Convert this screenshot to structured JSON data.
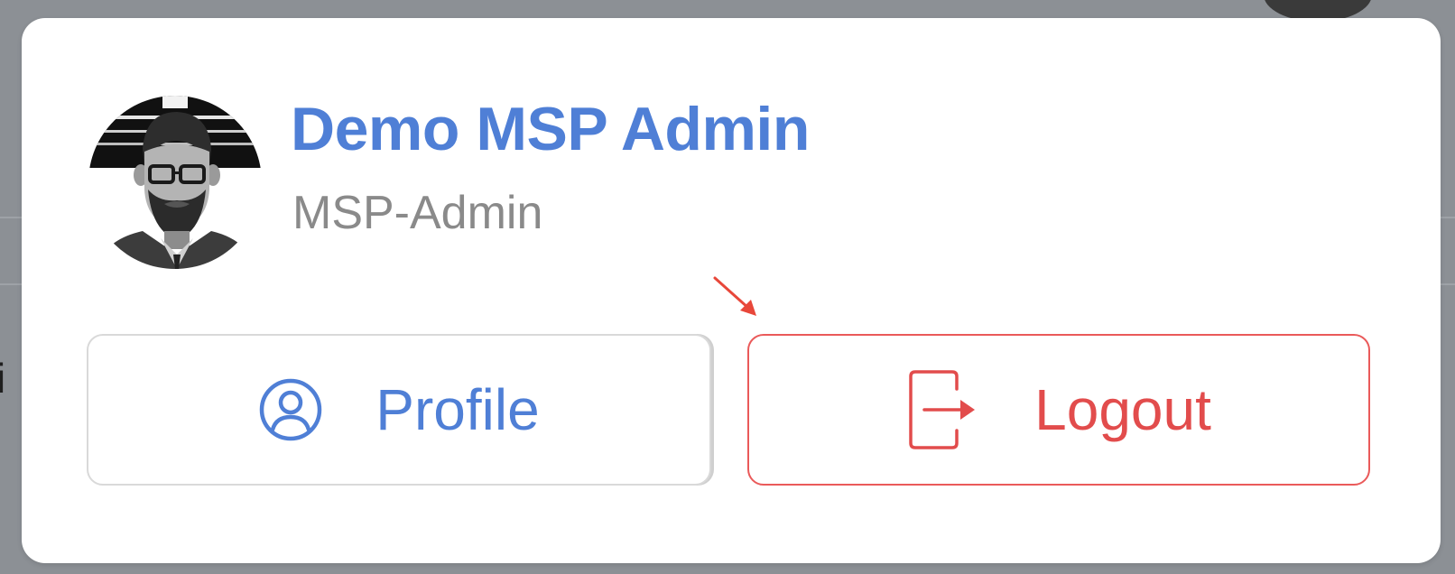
{
  "user": {
    "name": "Demo MSP Admin",
    "role": "MSP-Admin"
  },
  "actions": {
    "profile_label": "Profile",
    "logout_label": "Logout"
  },
  "background": {
    "partial_text": "i"
  },
  "icons": {
    "profile": "user-circle-icon",
    "logout": "logout-arrow-icon",
    "annotation": "red-pointer-arrow"
  },
  "colors": {
    "accent_blue": "#4f7fd6",
    "danger_red": "#e24c4c",
    "muted_text": "#8a8a8a",
    "overlay": "#8c9095"
  }
}
